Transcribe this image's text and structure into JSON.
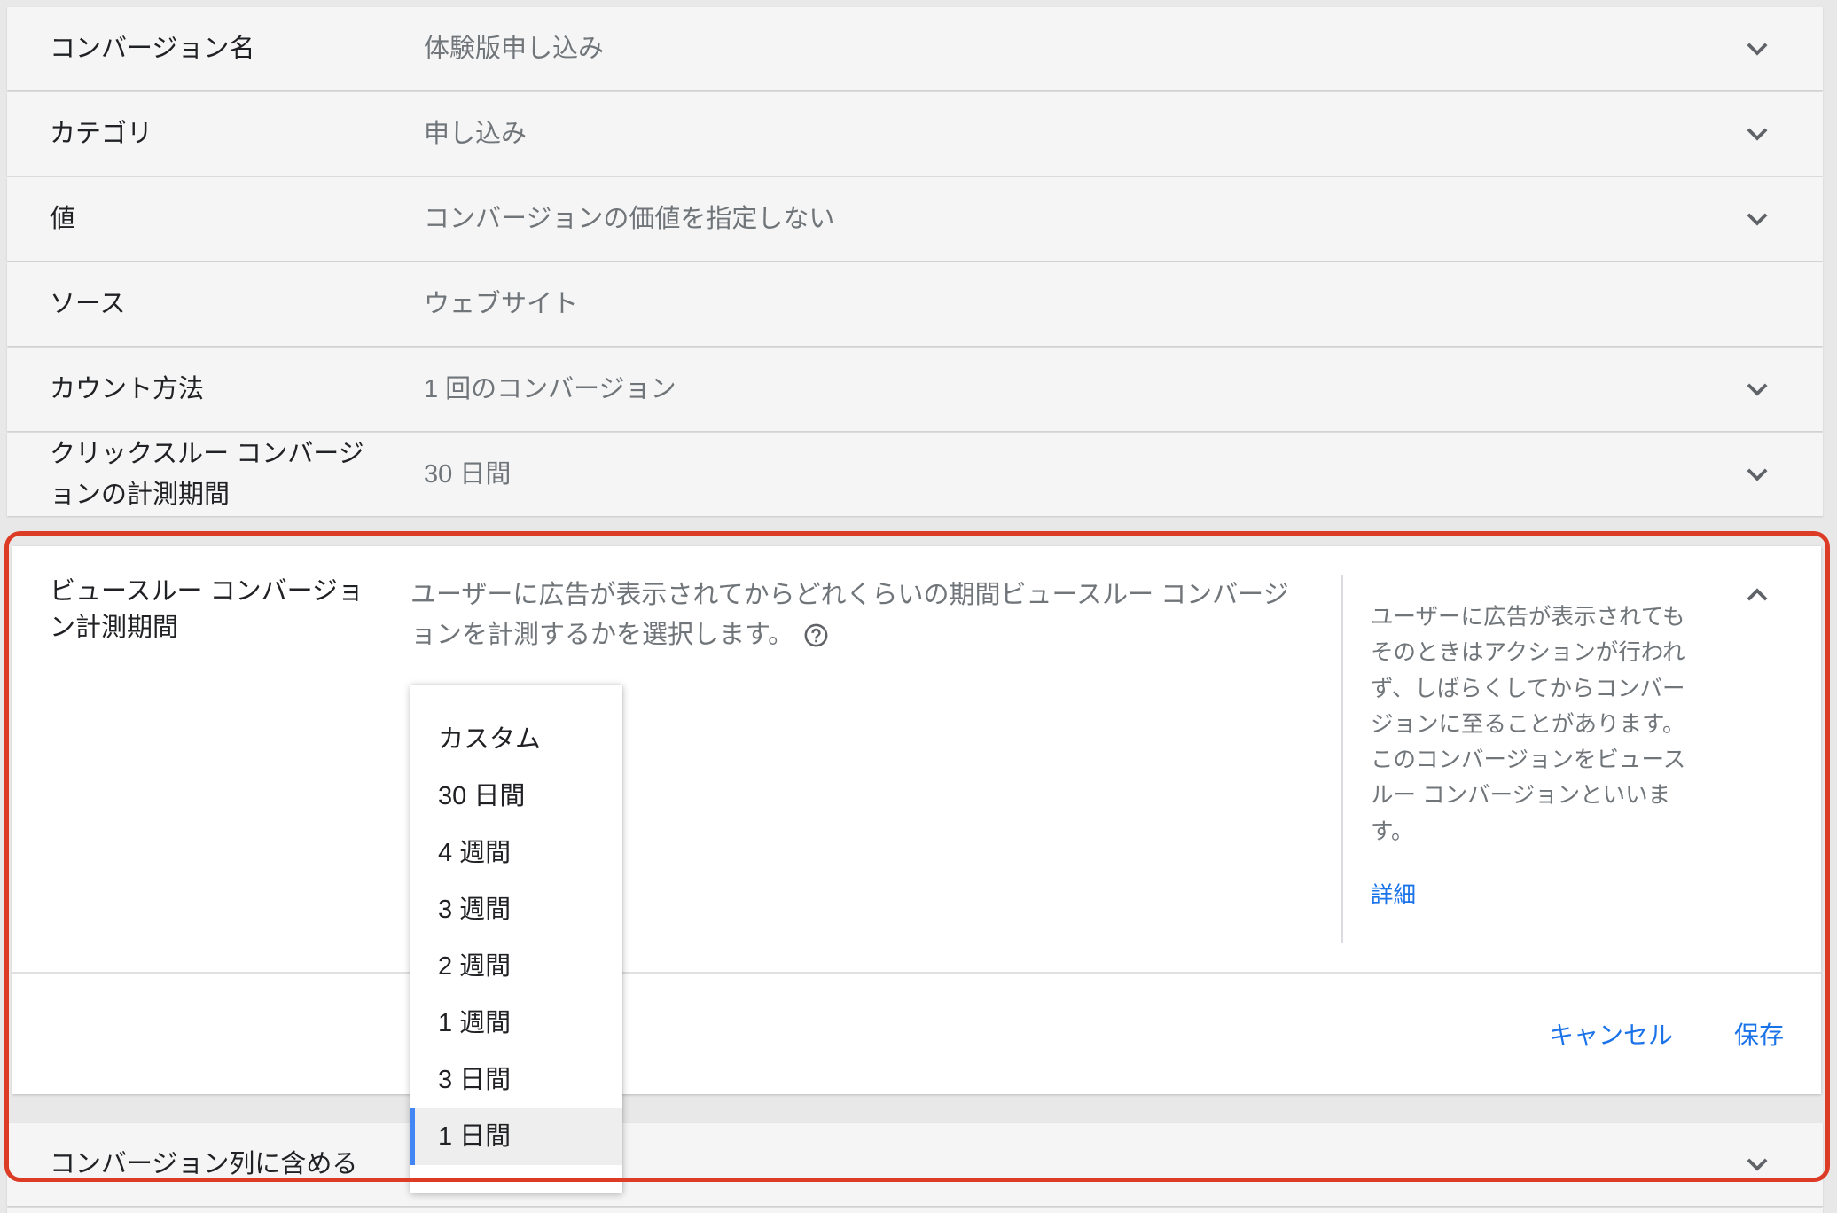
{
  "colors": {
    "accent": "#1a73e8",
    "selection_bar": "#4285f4",
    "highlight_frame": "#dc3b26"
  },
  "rows": [
    {
      "label_lines": [
        "コンバージョン名"
      ],
      "value": "体験版申し込み",
      "icon": "chevron-down-icon"
    },
    {
      "label_lines": [
        "カテゴリ"
      ],
      "value": "申し込み",
      "icon": "chevron-down-icon"
    },
    {
      "label_lines": [
        "値"
      ],
      "value": "コンバージョンの価値を指定しない",
      "icon": "chevron-down-icon"
    },
    {
      "label_lines": [
        "ソース"
      ],
      "value": "ウェブサイト",
      "icon": null
    },
    {
      "label_lines": [
        "カウント方法"
      ],
      "value": "1 回のコンバージョン",
      "icon": "chevron-down-icon"
    },
    {
      "label_lines": [
        "クリックスルー コンバージ",
        "ョンの計測期間"
      ],
      "value": "30 日間",
      "icon": "chevron-down-icon"
    }
  ],
  "expanded_section": {
    "label_lines": [
      "ビュースルー コンバージョ",
      "ン計測期間"
    ],
    "description_lines": [
      "ユーザーに広告が表示されてからどれくらいの期間ビュースルー コンバージ",
      "ョンを計測するかを選択します。"
    ],
    "description_icon": "help-outline-icon",
    "collapse_icon": "chevron-up-icon",
    "dropdown": {
      "options": [
        "カスタム",
        "30 日間",
        "4 週間",
        "3 週間",
        "2 週間",
        "1 週間",
        "3 日間",
        "1 日間"
      ],
      "selected_index": 7
    },
    "help_panel": {
      "lines": [
        "ユーザーに広告が表示されても",
        "そのときはアクションが行われ",
        "ず、しばらくしてからコンバー",
        "ジョンに至ることがあります。",
        "このコンバージョンをビュース",
        "ルー コンバージョンといいま",
        "す。"
      ],
      "link_label": "詳細"
    },
    "actions": {
      "cancel_label": "キャンセル",
      "save_label": "保存"
    }
  },
  "next_row": {
    "label": "コンバージョン列に含める",
    "icon": "chevron-down-icon"
  }
}
